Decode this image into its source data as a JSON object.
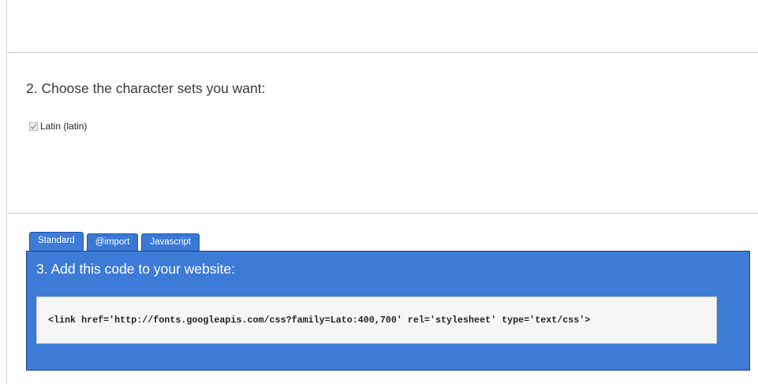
{
  "charset_section": {
    "title": "2. Choose the character sets you want:",
    "options": [
      {
        "label": "Latin (latin)",
        "checked": true,
        "disabled": true
      }
    ]
  },
  "code_section": {
    "tabs": [
      {
        "label": "Standard",
        "active": true
      },
      {
        "label": "@import",
        "active": false
      },
      {
        "label": "Javascript",
        "active": false
      }
    ],
    "title": "3. Add this code to your website:",
    "code": "<link href='http://fonts.googleapis.com/css?family=Lato:400,700' rel='stylesheet' type='text/css'>"
  },
  "colors": {
    "panel_blue": "#3d7bd6",
    "panel_border": "#1a3f9a",
    "code_background": "#f6f6f6"
  }
}
